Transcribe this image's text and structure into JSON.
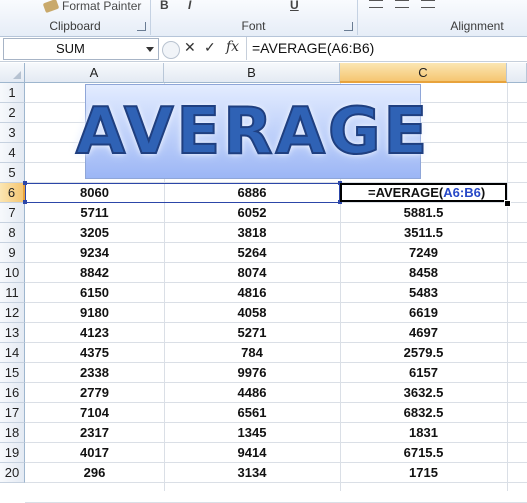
{
  "ribbon": {
    "format_painter_label": "Format Painter",
    "groups": [
      {
        "name": "Clipboard"
      },
      {
        "name": "Font"
      },
      {
        "name": "Alignment"
      }
    ],
    "font_buttons": [
      "B",
      "I",
      "U"
    ]
  },
  "formula_bar": {
    "name_box": "SUM",
    "cancel_icon": "✕",
    "enter_icon": "✓",
    "fx_label": "fx",
    "formula": "=AVERAGE(A6:B6)"
  },
  "columns": [
    "A",
    "B",
    "C"
  ],
  "selected_column": "C",
  "rows": [
    "1",
    "2",
    "3",
    "4",
    "5",
    "6",
    "7",
    "8",
    "9",
    "10",
    "11",
    "12",
    "13",
    "14",
    "15",
    "16",
    "17",
    "18",
    "19",
    "20"
  ],
  "selected_row": "6",
  "wordart": "AVERAGE",
  "active_cell": {
    "prefix": "=AVERAGE(",
    "ref": "A6:B6",
    "suffix": ")",
    "ref_color": "#2748c7"
  },
  "data": [
    [
      "8060",
      "6886",
      ""
    ],
    [
      "5711",
      "6052",
      "5881.5"
    ],
    [
      "3205",
      "3818",
      "3511.5"
    ],
    [
      "9234",
      "5264",
      "7249"
    ],
    [
      "8842",
      "8074",
      "8458"
    ],
    [
      "6150",
      "4816",
      "5483"
    ],
    [
      "9180",
      "4058",
      "6619"
    ],
    [
      "4123",
      "5271",
      "4697"
    ],
    [
      "4375",
      "784",
      "2579.5"
    ],
    [
      "2338",
      "9976",
      "6157"
    ],
    [
      "2779",
      "4486",
      "3632.5"
    ],
    [
      "7104",
      "6561",
      "6832.5"
    ],
    [
      "2317",
      "1345",
      "1831"
    ],
    [
      "4017",
      "9414",
      "6715.5"
    ],
    [
      "296",
      "3134",
      "1715"
    ]
  ]
}
